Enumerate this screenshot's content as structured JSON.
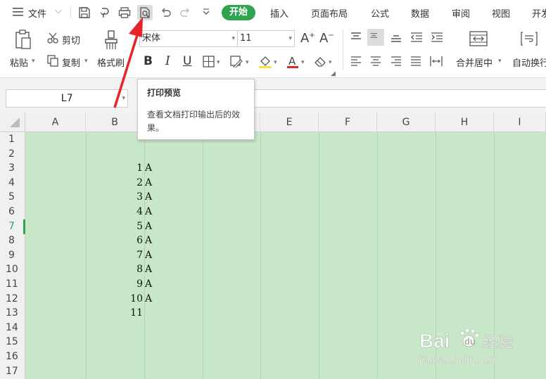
{
  "menubar": {
    "file_menu": "文件",
    "tabs": [
      {
        "label": "开始",
        "active": true
      },
      {
        "label": "插入",
        "active": false
      },
      {
        "label": "页面布局",
        "active": false
      },
      {
        "label": "公式",
        "active": false
      },
      {
        "label": "数据",
        "active": false
      },
      {
        "label": "审阅",
        "active": false
      },
      {
        "label": "视图",
        "active": false
      },
      {
        "label": "开发",
        "active": false
      }
    ]
  },
  "ribbon": {
    "paste": "粘贴",
    "cut": "剪切",
    "copy": "复制",
    "format_painter": "格式刷",
    "font_name": "宋体",
    "font_size": "11",
    "merge_center": "合并居中",
    "auto_wrap": "自动换行"
  },
  "formula_bar": {
    "name_box": "L7",
    "formula": ""
  },
  "tooltip": {
    "title": "打印预览",
    "description": "查看文档打印输出后的效果。"
  },
  "grid": {
    "columns": [
      "A",
      "B",
      "C",
      "D",
      "E",
      "F",
      "G",
      "H",
      "I"
    ],
    "rows": [
      "1",
      "2",
      "3",
      "4",
      "5",
      "6",
      "7",
      "8",
      "9",
      "10",
      "11",
      "12",
      "13",
      "14",
      "15",
      "16",
      "17"
    ],
    "selected_row": "7",
    "cells": [
      {
        "row": "3",
        "col": "B",
        "num": "1",
        "letter": "A"
      },
      {
        "row": "4",
        "col": "B",
        "num": "2",
        "letter": "A"
      },
      {
        "row": "5",
        "col": "B",
        "num": "3",
        "letter": "A"
      },
      {
        "row": "6",
        "col": "B",
        "num": "4",
        "letter": "A"
      },
      {
        "row": "7",
        "col": "B",
        "num": "5",
        "letter": "A"
      },
      {
        "row": "8",
        "col": "B",
        "num": "6",
        "letter": "A"
      },
      {
        "row": "9",
        "col": "B",
        "num": "7",
        "letter": "A"
      },
      {
        "row": "10",
        "col": "B",
        "num": "8",
        "letter": "A"
      },
      {
        "row": "11",
        "col": "B",
        "num": "9",
        "letter": "A"
      },
      {
        "row": "12",
        "col": "B",
        "num": "10",
        "letter": "A"
      },
      {
        "row": "13",
        "col": "B",
        "num": "11",
        "letter": ""
      }
    ]
  },
  "watermark": {
    "text": "Bai 经验",
    "url": "jingyan.baidu.com"
  },
  "colors": {
    "accent": "#2fa34f",
    "cell_fill": "#c8e6c8",
    "arrow": "#e8232a"
  }
}
